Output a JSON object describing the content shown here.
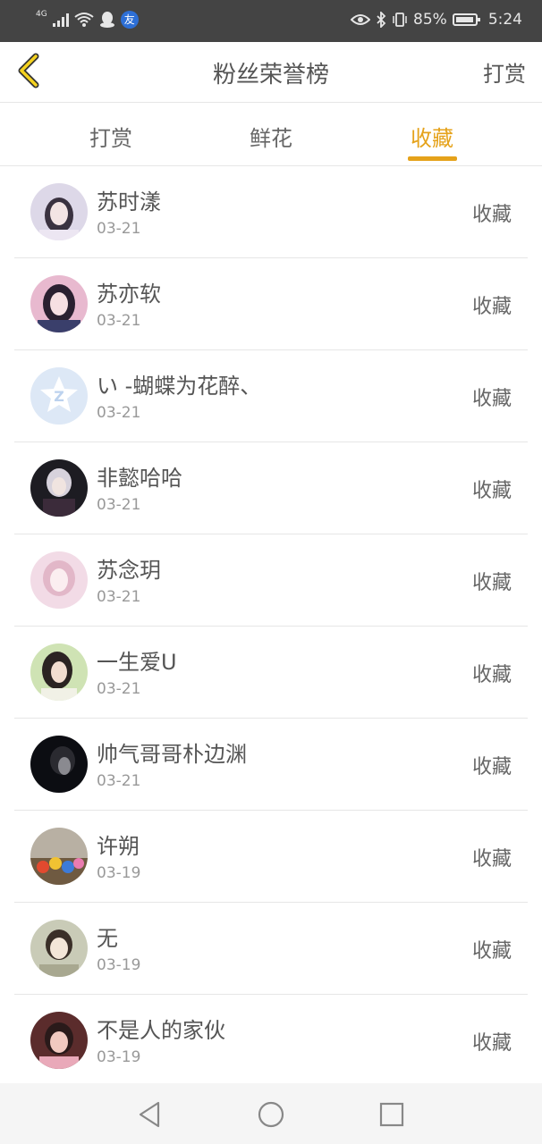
{
  "status": {
    "network": "4G",
    "app_badge": "友",
    "battery": "85%",
    "time": "5:24"
  },
  "header": {
    "title": "粉丝荣誉榜",
    "action": "打赏"
  },
  "tabs": [
    {
      "label": "打赏",
      "active": false
    },
    {
      "label": "鲜花",
      "active": false
    },
    {
      "label": "收藏",
      "active": true
    }
  ],
  "accent_color": "#e5a21a",
  "list": [
    {
      "name": "苏时漾",
      "date": "03-21",
      "action": "收藏"
    },
    {
      "name": "苏亦软",
      "date": "03-21",
      "action": "收藏"
    },
    {
      "name": "い -蝴蝶为花醉、",
      "date": "03-21",
      "action": "收藏"
    },
    {
      "name": "非懿哈哈",
      "date": "03-21",
      "action": "收藏"
    },
    {
      "name": "苏念玥",
      "date": "03-21",
      "action": "收藏"
    },
    {
      "name": "一生爱U",
      "date": "03-21",
      "action": "收藏"
    },
    {
      "name": "帅气哥哥朴边渊",
      "date": "03-21",
      "action": "收藏"
    },
    {
      "name": "许朔",
      "date": "03-19",
      "action": "收藏"
    },
    {
      "name": "无",
      "date": "03-19",
      "action": "收藏"
    },
    {
      "name": "不是人的家伙",
      "date": "03-19",
      "action": "收藏"
    }
  ]
}
